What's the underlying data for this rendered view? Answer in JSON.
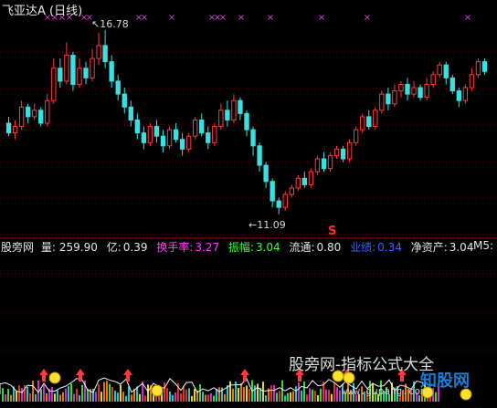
{
  "title": "飞亚达A (日线)",
  "high_label": "16.78",
  "low_label": "11.09",
  "sell_mark": "S",
  "info": {
    "site": "股旁网",
    "vol_label": "量:",
    "vol_value": "259.90",
    "amt_label": "亿:",
    "amt_value": "0.39",
    "turnover_label": "换手率:",
    "turnover_value": "3.27",
    "amplitude_label": "振幅:",
    "amplitude_value": "3.04",
    "float_label": "流通:",
    "float_value": "0.80",
    "perf_label": "业绩:",
    "perf_value": "0.34",
    "nav_label": "净资产:",
    "nav_value": "3.04",
    "m5_label": "M5:"
  },
  "watermark": {
    "title": "股旁网-指标公式大全",
    "logo": "知股网",
    "url": "www.gupang.com"
  },
  "colors": {
    "up": "#ff3b3b",
    "down": "#3ae0e0",
    "cross": "#e040e0",
    "turnover": "#ff40ff",
    "amplitude": "#40ff40",
    "perf": "#4060ff"
  },
  "chart_data": {
    "type": "candlestick",
    "title": "飞亚达A (日线)",
    "ylim": [
      10.6,
      17.2
    ],
    "high": 16.78,
    "low": 11.09,
    "candles": [
      [
        13.9,
        13.6,
        14.1,
        13.5
      ],
      [
        13.6,
        13.8,
        14.0,
        13.4
      ],
      [
        13.8,
        14.4,
        14.6,
        13.7
      ],
      [
        14.4,
        14.1,
        14.5,
        13.9
      ],
      [
        14.1,
        14.3,
        14.5,
        14.0
      ],
      [
        14.3,
        13.9,
        14.4,
        13.8
      ],
      [
        13.9,
        14.6,
        14.8,
        13.8
      ],
      [
        14.6,
        15.6,
        15.9,
        14.5
      ],
      [
        15.6,
        15.2,
        15.9,
        15.0
      ],
      [
        15.2,
        16.0,
        16.4,
        15.1
      ],
      [
        16.0,
        15.1,
        16.1,
        14.9
      ],
      [
        15.1,
        15.6,
        15.9,
        15.0
      ],
      [
        15.6,
        15.3,
        15.8,
        15.1
      ],
      [
        15.3,
        15.9,
        16.2,
        15.2
      ],
      [
        15.9,
        16.3,
        16.7,
        15.7
      ],
      [
        16.3,
        15.8,
        16.78,
        15.6
      ],
      [
        15.8,
        15.2,
        16.0,
        15.0
      ],
      [
        15.2,
        14.8,
        15.4,
        14.6
      ],
      [
        14.8,
        14.4,
        15.0,
        14.2
      ],
      [
        14.4,
        14.0,
        14.6,
        13.8
      ],
      [
        14.0,
        13.6,
        14.2,
        13.4
      ],
      [
        13.6,
        13.3,
        13.8,
        13.1
      ],
      [
        13.3,
        13.8,
        13.9,
        13.2
      ],
      [
        13.8,
        13.5,
        14.0,
        13.3
      ],
      [
        13.5,
        13.2,
        13.7,
        13.0
      ],
      [
        13.2,
        13.7,
        13.8,
        13.1
      ],
      [
        13.7,
        13.4,
        13.9,
        13.3
      ],
      [
        13.4,
        13.1,
        13.6,
        12.9
      ],
      [
        13.1,
        13.5,
        13.6,
        13.0
      ],
      [
        13.5,
        14.0,
        14.1,
        13.4
      ],
      [
        14.0,
        13.6,
        14.2,
        13.5
      ],
      [
        13.6,
        13.3,
        13.8,
        13.1
      ],
      [
        13.3,
        13.8,
        13.9,
        13.2
      ],
      [
        13.8,
        14.3,
        14.5,
        13.7
      ],
      [
        14.3,
        14.0,
        14.6,
        13.8
      ],
      [
        14.0,
        14.6,
        14.8,
        13.9
      ],
      [
        14.6,
        14.2,
        14.7,
        14.0
      ],
      [
        14.2,
        13.7,
        14.3,
        13.5
      ],
      [
        13.7,
        13.2,
        13.8,
        12.9
      ],
      [
        13.2,
        12.6,
        13.3,
        12.4
      ],
      [
        12.6,
        12.1,
        12.7,
        11.9
      ],
      [
        12.1,
        11.5,
        12.2,
        11.3
      ],
      [
        11.5,
        11.3,
        11.6,
        11.09
      ],
      [
        11.3,
        11.7,
        11.8,
        11.2
      ],
      [
        11.7,
        11.9,
        12.0,
        11.6
      ],
      [
        11.9,
        12.2,
        12.3,
        11.8
      ],
      [
        12.2,
        12.0,
        12.4,
        11.9
      ],
      [
        12.0,
        12.4,
        12.5,
        11.9
      ],
      [
        12.4,
        12.8,
        12.9,
        12.3
      ],
      [
        12.8,
        12.5,
        13.0,
        12.4
      ],
      [
        12.5,
        12.9,
        13.0,
        12.4
      ],
      [
        12.9,
        13.1,
        13.2,
        12.8
      ],
      [
        13.1,
        12.8,
        13.2,
        12.7
      ],
      [
        12.8,
        13.3,
        13.4,
        12.7
      ],
      [
        13.3,
        13.7,
        13.8,
        13.2
      ],
      [
        13.7,
        14.1,
        14.2,
        13.6
      ],
      [
        14.1,
        13.8,
        14.3,
        13.7
      ],
      [
        13.8,
        14.3,
        14.4,
        13.7
      ],
      [
        14.3,
        14.8,
        14.9,
        14.2
      ],
      [
        14.8,
        14.5,
        15.0,
        14.3
      ],
      [
        14.5,
        14.9,
        15.1,
        14.4
      ],
      [
        14.9,
        15.1,
        15.2,
        14.7
      ],
      [
        15.1,
        14.8,
        15.3,
        14.6
      ],
      [
        14.8,
        15.0,
        15.2,
        14.7
      ],
      [
        15.0,
        14.7,
        15.1,
        14.6
      ],
      [
        14.7,
        15.1,
        15.3,
        14.6
      ],
      [
        15.1,
        15.4,
        15.5,
        15.0
      ],
      [
        15.4,
        15.7,
        15.8,
        15.3
      ],
      [
        15.7,
        15.3,
        15.8,
        15.1
      ],
      [
        15.3,
        14.9,
        15.4,
        14.8
      ],
      [
        14.9,
        14.6,
        15.0,
        14.4
      ],
      [
        14.6,
        15.0,
        15.1,
        14.5
      ],
      [
        15.0,
        15.4,
        15.6,
        14.9
      ],
      [
        15.4,
        15.8,
        15.9,
        15.3
      ],
      [
        15.8,
        15.5,
        15.9,
        15.4
      ]
    ]
  }
}
